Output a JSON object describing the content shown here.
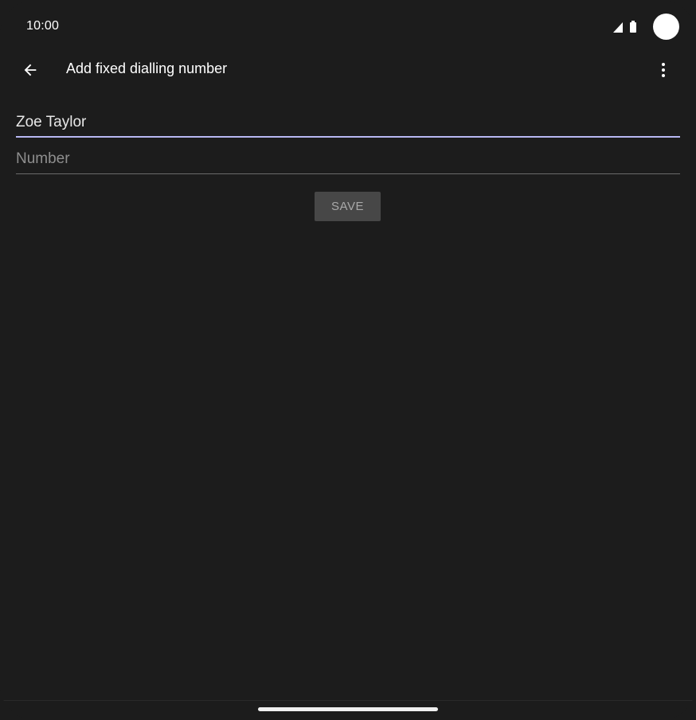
{
  "status_bar": {
    "time": "10:00",
    "icons": [
      "cellular-signal-icon",
      "battery-icon"
    ]
  },
  "app_bar": {
    "title": "Add fixed dialling number",
    "back_icon": "arrow-back-icon",
    "menu_icon": "more-vert-icon"
  },
  "form": {
    "name_value": "Zoe Taylor",
    "name_placeholder": "",
    "number_value": "",
    "number_placeholder": "Number",
    "save_label": "SAVE"
  },
  "colors": {
    "background": "#1c1c1c",
    "focused_underline": "#b8b8f2",
    "button_background": "#474747"
  }
}
